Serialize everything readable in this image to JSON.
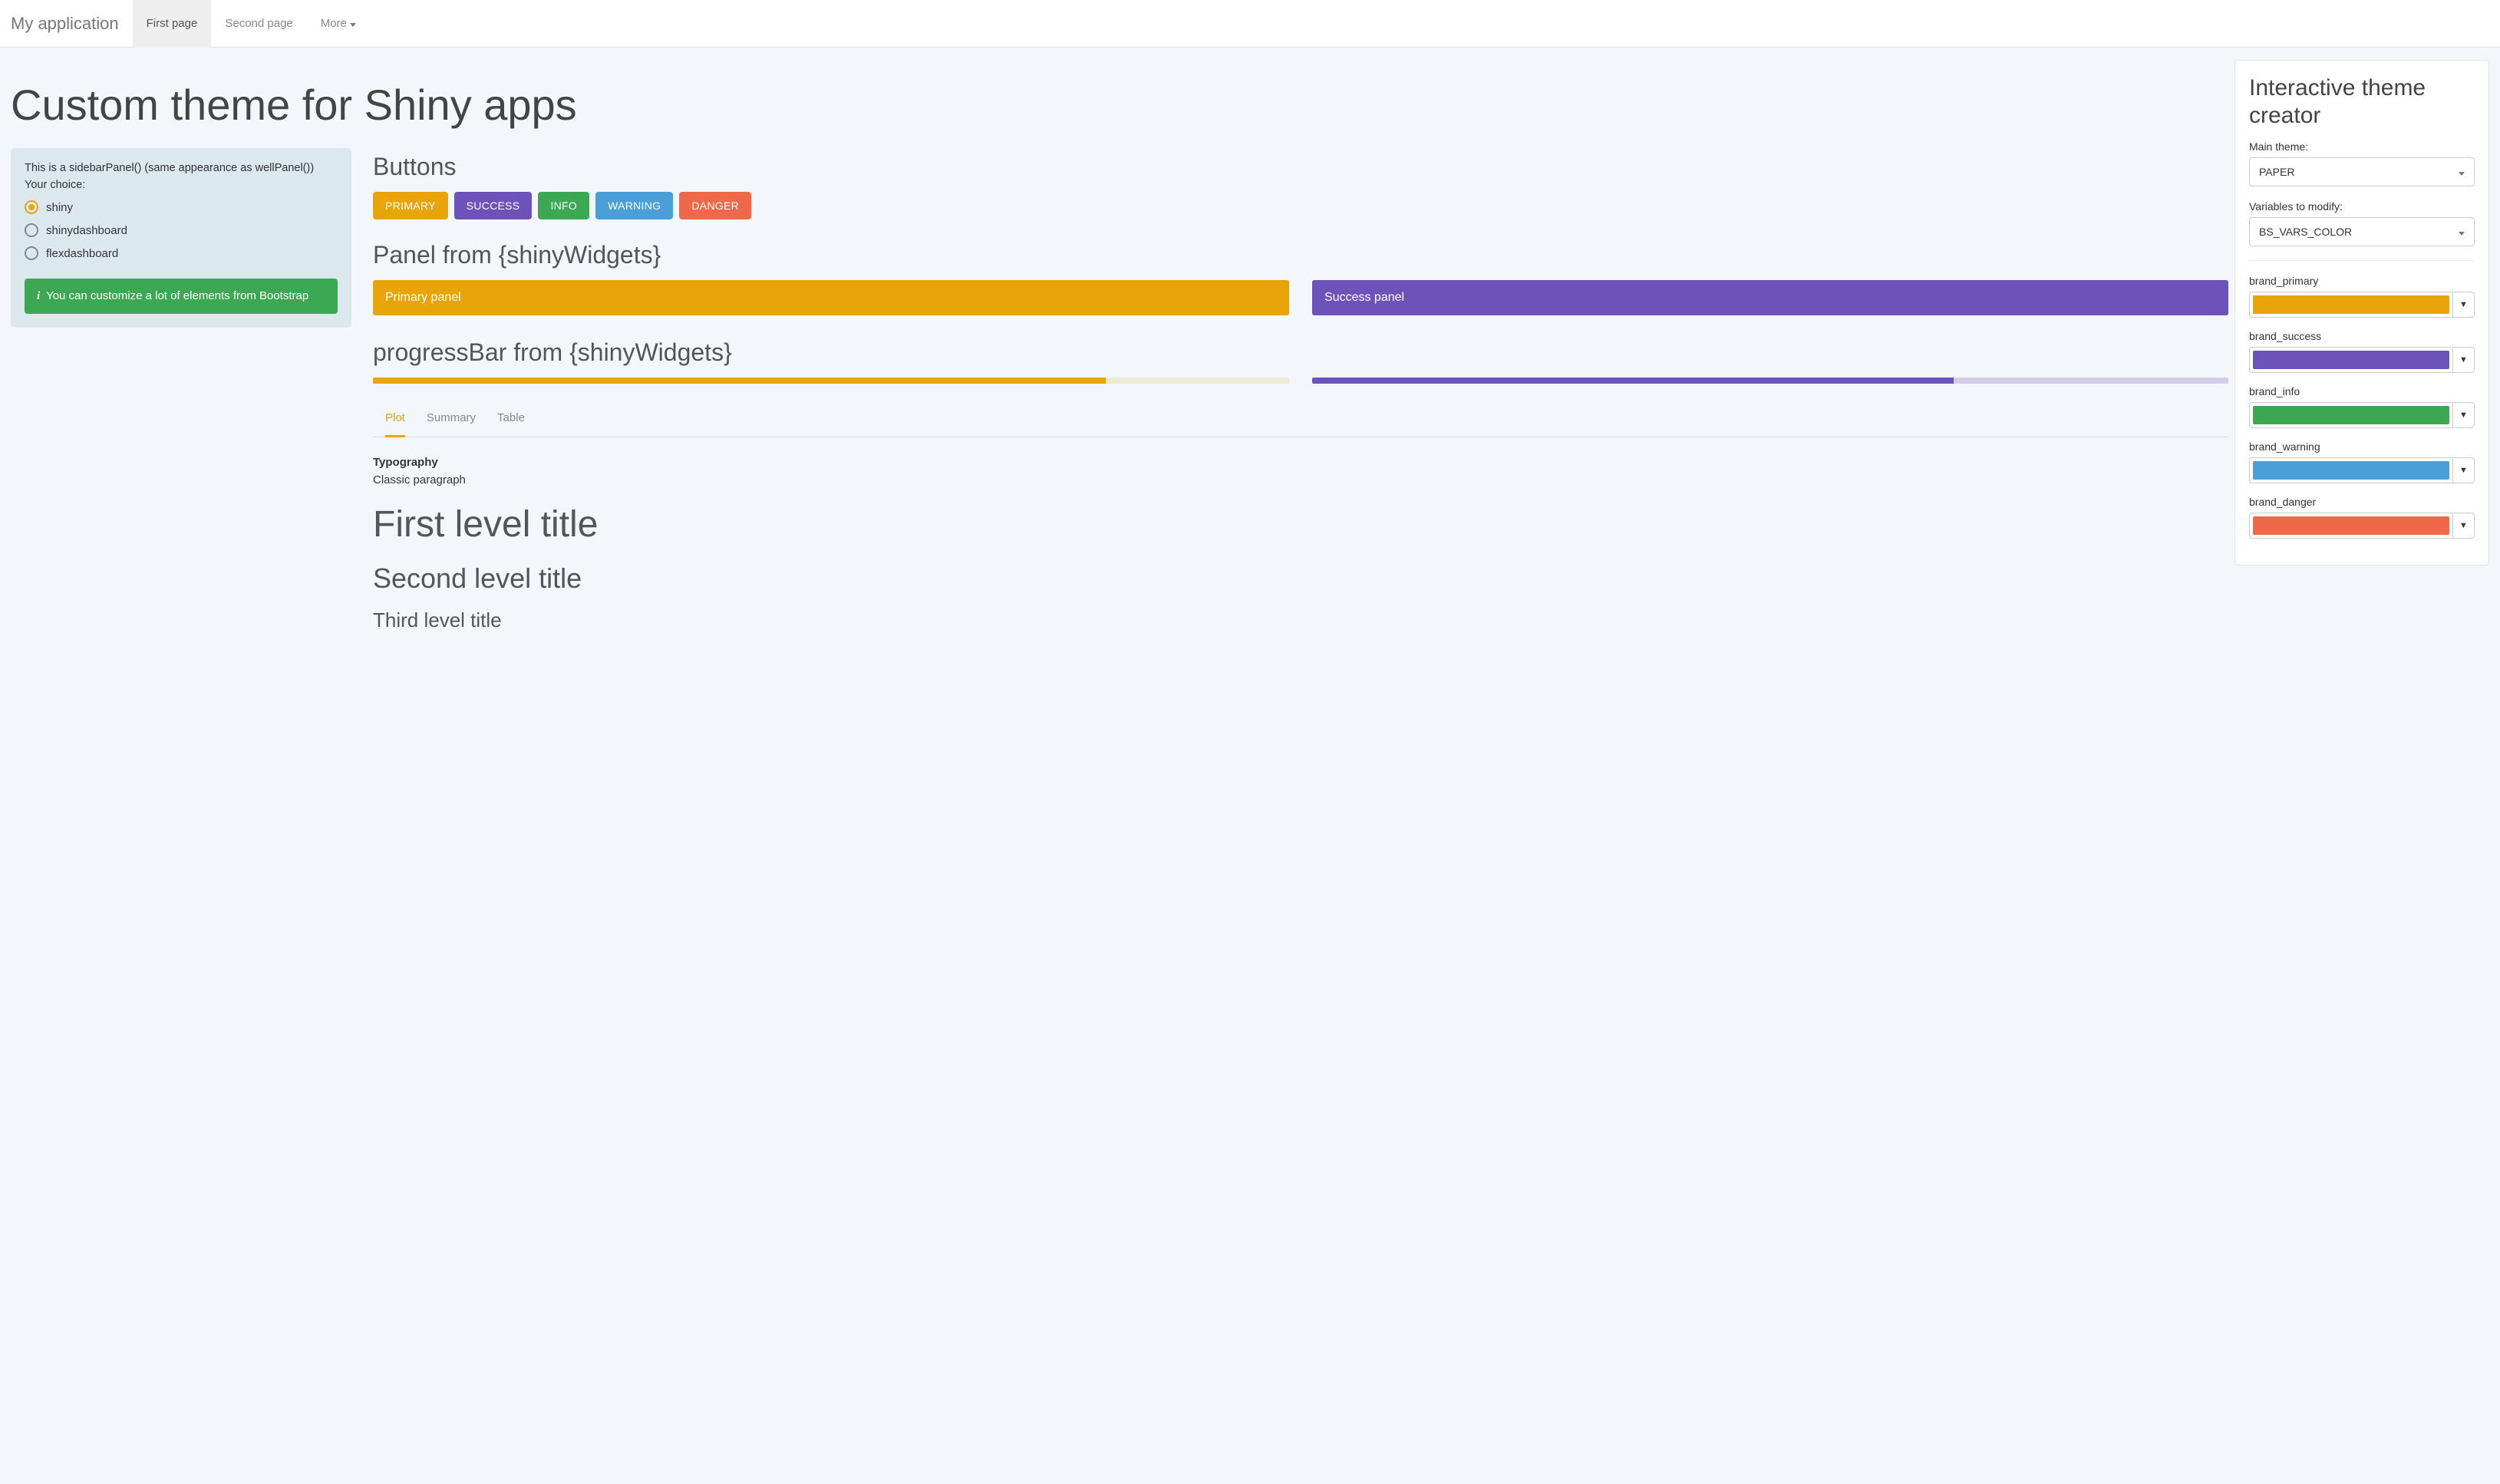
{
  "navbar": {
    "brand": "My application",
    "items": [
      {
        "label": "First page",
        "active": true
      },
      {
        "label": "Second page",
        "active": false
      },
      {
        "label": "More",
        "active": false,
        "dropdown": true
      }
    ]
  },
  "title": "Custom theme for Shiny apps",
  "sidebar": {
    "intro": "This is a sidebarPanel() (same appearance as wellPanel())",
    "choice_label": "Your choice:",
    "options": [
      {
        "label": "shiny",
        "selected": true
      },
      {
        "label": "shinydashboard",
        "selected": false
      },
      {
        "label": "flexdashboard",
        "selected": false
      }
    ],
    "alert": "You can customize a lot of elements from Bootstrap"
  },
  "sections": {
    "buttons_title": "Buttons",
    "buttons": [
      {
        "label": "PRIMARY",
        "class": "btn-primary"
      },
      {
        "label": "SUCCESS",
        "class": "btn-success"
      },
      {
        "label": "INFO",
        "class": "btn-info"
      },
      {
        "label": "WARNING",
        "class": "btn-warning"
      },
      {
        "label": "DANGER",
        "class": "btn-danger"
      }
    ],
    "panel_title": "Panel from {shinyWidgets}",
    "panels": [
      {
        "label": "Primary panel",
        "class": "panel-primary"
      },
      {
        "label": "Success panel",
        "class": "panel-success"
      }
    ],
    "progress_title": "progressBar from {shinyWidgets}",
    "progress": [
      {
        "value": 80,
        "bar_class": "bar-primary",
        "track_class": ""
      },
      {
        "value": 70,
        "bar_class": "bar-success",
        "track_class": "success-track"
      }
    ],
    "tabs": [
      {
        "label": "Plot",
        "active": true
      },
      {
        "label": "Summary",
        "active": false
      },
      {
        "label": "Table",
        "active": false
      }
    ],
    "typography": {
      "heading": "Typography",
      "paragraph": "Classic paragraph",
      "h1": "First level title",
      "h2": "Second level title",
      "h3": "Third level title"
    }
  },
  "theme_panel": {
    "title": "Interactive theme creator",
    "main_theme_label": "Main theme:",
    "main_theme_value": "PAPER",
    "vars_label": "Variables to modify:",
    "vars_value": "BS_VARS_COLOR",
    "colors": [
      {
        "name": "brand_primary",
        "hex": "#e9a40a"
      },
      {
        "name": "brand_success",
        "hex": "#6c53b9"
      },
      {
        "name": "brand_info",
        "hex": "#3da853"
      },
      {
        "name": "brand_warning",
        "hex": "#4a9fd8"
      },
      {
        "name": "brand_danger",
        "hex": "#ef6849"
      }
    ]
  }
}
